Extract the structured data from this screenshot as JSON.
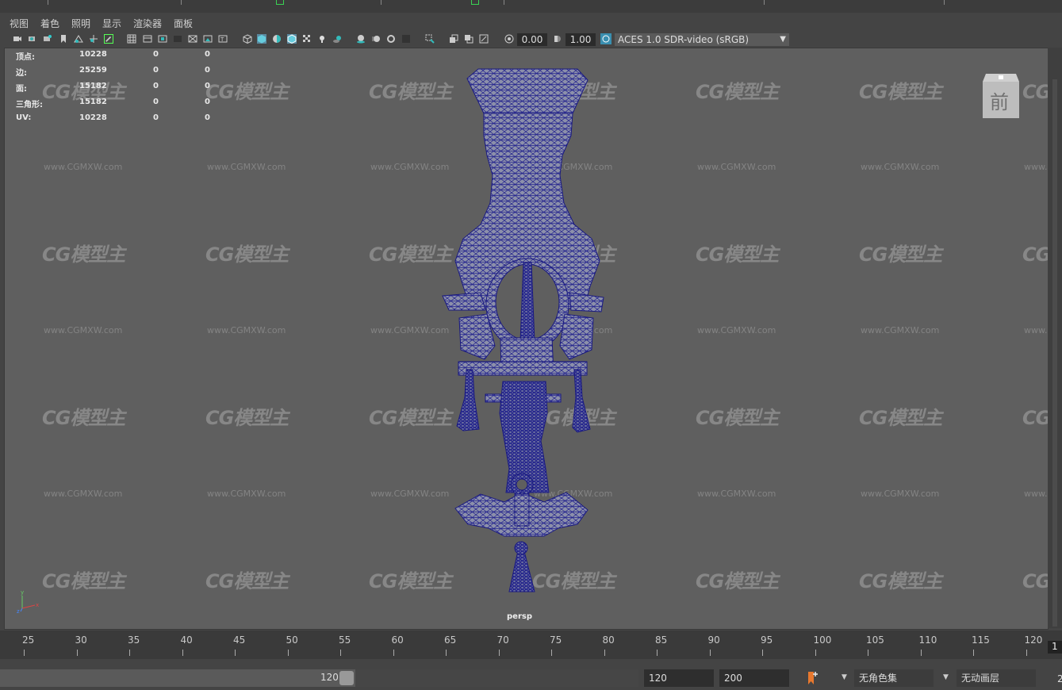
{
  "menu": {
    "items": [
      "视图",
      "着色",
      "照明",
      "显示",
      "渲染器",
      "面板"
    ]
  },
  "toolbar": {
    "exposure": "0.00",
    "gamma": "1.00",
    "color_space": "ACES 1.0 SDR-video (sRGB)"
  },
  "hud": {
    "rows": [
      {
        "label": "顶点:",
        "total": "10228",
        "sel": "0",
        "comp": "0"
      },
      {
        "label": "边:",
        "total": "25259",
        "sel": "0",
        "comp": "0"
      },
      {
        "label": "面:",
        "total": "15182",
        "sel": "0",
        "comp": "0"
      },
      {
        "label": "三角形:",
        "total": "15182",
        "sel": "0",
        "comp": "0"
      },
      {
        "label": "UV:",
        "total": "10228",
        "sel": "0",
        "comp": "0"
      }
    ]
  },
  "viewcube": {
    "label": "前"
  },
  "camera": {
    "name": "persp"
  },
  "watermark": {
    "logo": "CG模型主",
    "url": "www.CGMXW.com"
  },
  "timeline": {
    "ticks": [
      "25",
      "30",
      "35",
      "40",
      "45",
      "50",
      "55",
      "60",
      "65",
      "70",
      "75",
      "80",
      "85",
      "90",
      "95",
      "100",
      "105",
      "110",
      "115",
      "120"
    ],
    "current_frame": "1"
  },
  "range": {
    "slider_end": "120",
    "end_field": "120",
    "max_field": "200",
    "character_set": "无角色集",
    "anim_layer": "无动画层",
    "fps_partial": "2"
  },
  "colors": {
    "wire": "#1f1f8a",
    "mesh": "#8a8ea8",
    "bg": "#5f5f5f"
  }
}
